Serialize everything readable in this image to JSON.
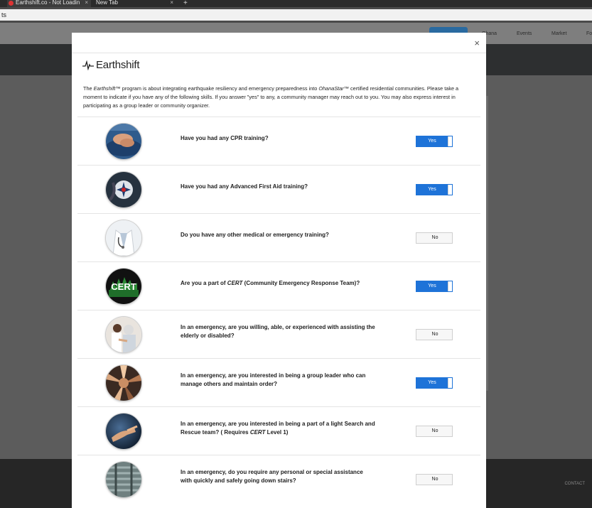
{
  "browser": {
    "tabs": [
      {
        "label": "Earthshift.co - Not Loadin",
        "active": true
      },
      {
        "label": "New Tab",
        "active": false
      }
    ],
    "new_tab_symbol": "+",
    "address": "ts"
  },
  "site": {
    "nav": [
      "Ohana",
      "Events",
      "Market",
      "Fo"
    ],
    "footer_contact": "CONTACT"
  },
  "modal": {
    "close_symbol": "×",
    "logo_text": "Earthshift",
    "intro_parts": [
      "The ",
      "Earthshift™",
      " program is about integrating earthquake resiliency and emergency preparedness into ",
      "OhanaStar™",
      " certified residential communities. Please take a moment to indicate if you have any of the following skills. If you answer \"yes\" to any, a community manager may reach out to you. You may also express interest in participating as a group leader or community organizer."
    ],
    "questions": [
      {
        "text_pre": "Have you had any CPR training?",
        "text_italic": "",
        "text_post": "",
        "answer": "Yes",
        "image": "cpr-training-image"
      },
      {
        "text_pre": "Have you had any Advanced First Aid training?",
        "text_italic": "",
        "text_post": "",
        "answer": "Yes",
        "image": "first-aid-image"
      },
      {
        "text_pre": "Do you have any other medical or emergency training?",
        "text_italic": "",
        "text_post": "",
        "answer": "No",
        "image": "doctor-image"
      },
      {
        "text_pre": "Are you a part of ",
        "text_italic": "CERT",
        "text_post": " (Community Emergency Response Team)?",
        "answer": "Yes",
        "image": "cert-logo-image"
      },
      {
        "text_pre": "In an emergency, are you willing, able, or experienced with assisting the elderly or disabled?",
        "text_italic": "",
        "text_post": "",
        "answer": "No",
        "image": "elderly-care-image"
      },
      {
        "text_pre": "In an emergency, are you interested in being a group leader who can manage others and maintain order?",
        "text_italic": "",
        "text_post": "",
        "answer": "Yes",
        "image": "group-hands-image"
      },
      {
        "text_pre": "In an emergency, are you interested in being a part of a light Search and Rescue team? ( Requires ",
        "text_italic": "CERT",
        "text_post": " Level 1)",
        "answer": "No",
        "image": "rescue-hand-image"
      },
      {
        "text_pre": "In an emergency, do you require any personal or special assistance with quickly and safely going down stairs?",
        "text_italic": "",
        "text_post": "",
        "answer": "No",
        "image": "stairs-image"
      }
    ]
  },
  "colors": {
    "toggle_yes": "#1e73d8",
    "toggle_no": "#f7f7f7"
  }
}
